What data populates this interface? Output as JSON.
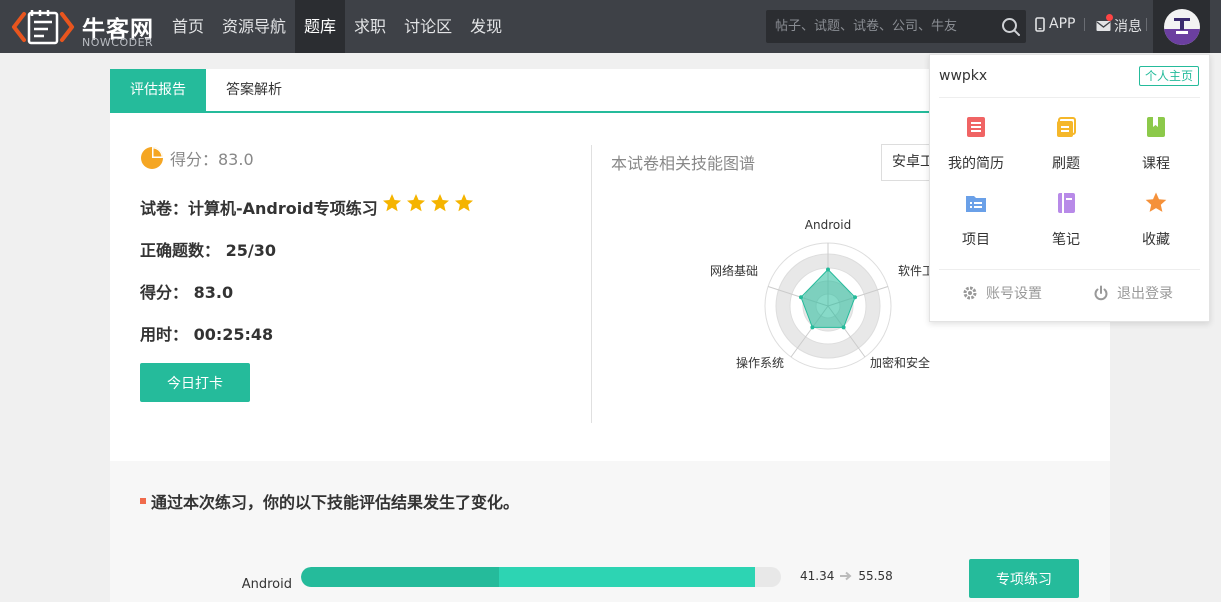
{
  "brand": {
    "name": "牛客网",
    "sub": "NOWCODER"
  },
  "nav": [
    "首页",
    "资源导航",
    "题库",
    "求职",
    "讨论区",
    "发现"
  ],
  "nav_active": 2,
  "search": {
    "placeholder": "帖子、试题、试卷、公司、牛友"
  },
  "header": {
    "app": "APP",
    "messages": "消息"
  },
  "tabs": [
    "评估报告",
    "答案解析"
  ],
  "report": {
    "score_label": "得分：83.0",
    "paper_label": "试卷：",
    "paper_name": "计算机-Android专项练习",
    "stars": 4,
    "correct_label": "正确题数：",
    "correct_value": "25/30",
    "score_title": "得分：",
    "score_value": "83.0",
    "time_label": "用时：",
    "time_value": "00:25:48",
    "checkin_button": "今日打卡"
  },
  "radar": {
    "title": "本试卷相关技能图谱",
    "select_value": "安卓工",
    "axes": [
      "Android",
      "软件工",
      "加密和安全",
      "操作系统",
      "网络基础"
    ]
  },
  "change": {
    "title": "通过本次练习，你的以下技能评估结果发生了变化。",
    "skill": "Android",
    "old_value": 41.34,
    "new_value": 55.58,
    "old_label": "41.34",
    "new_label": "55.58",
    "button": "专项练习"
  },
  "dropdown": {
    "username": "wwpkx",
    "home_link": "个人主页",
    "items": [
      {
        "label": "我的简历",
        "icon": "resume-icon",
        "color": "#f06464"
      },
      {
        "label": "刷题",
        "icon": "practice-icon",
        "color": "#f5b72a"
      },
      {
        "label": "课程",
        "icon": "course-icon",
        "color": "#8cc94a"
      },
      {
        "label": "项目",
        "icon": "project-icon",
        "color": "#6aa0e8"
      },
      {
        "label": "笔记",
        "icon": "notes-icon",
        "color": "#b88ae8"
      },
      {
        "label": "收藏",
        "icon": "favorite-icon",
        "color": "#f5913a"
      }
    ],
    "settings": "账号设置",
    "logout": "退出登录"
  },
  "colors": {
    "accent": "#25bb9b",
    "nav_bg": "#3e4147",
    "star": "#f5b400"
  }
}
